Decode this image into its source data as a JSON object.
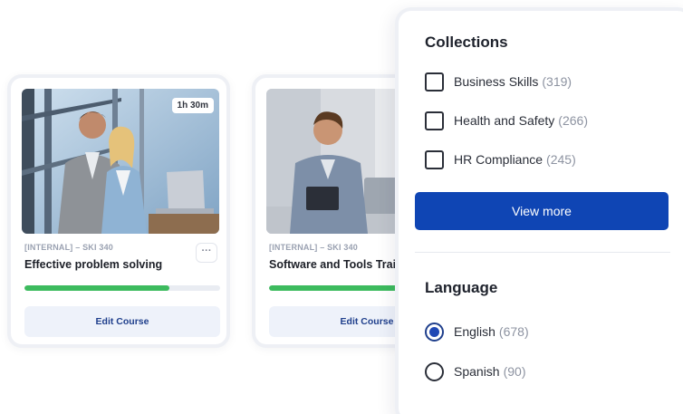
{
  "courses": [
    {
      "duration": "1h 30m",
      "code": "[INTERNAL] – SKI 340",
      "title": "Effective problem solving",
      "progress": 0.74,
      "more_label": "···",
      "edit_label": "Edit Course"
    },
    {
      "duration": "",
      "code": "[INTERNAL] – SKI 340",
      "title": "Software and Tools Training",
      "progress": 0.72,
      "more_label": "",
      "edit_label": "Edit Course"
    }
  ],
  "filters": {
    "collections": {
      "title": "Collections",
      "items": [
        {
          "label": "Business Skills",
          "count": "(319)",
          "checked": false
        },
        {
          "label": "Health and Safety",
          "count": "(266)",
          "checked": false
        },
        {
          "label": "HR Compliance",
          "count": "(245)",
          "checked": false
        }
      ],
      "view_more_label": "View more"
    },
    "language": {
      "title": "Language",
      "items": [
        {
          "label": "English",
          "count": "(678)",
          "selected": true
        },
        {
          "label": "Spanish",
          "count": "(90)",
          "selected": false
        }
      ]
    }
  },
  "colors": {
    "primary": "#0f45b4",
    "progress": "#3dbb5e",
    "edit_button_bg": "#eef2fa"
  }
}
